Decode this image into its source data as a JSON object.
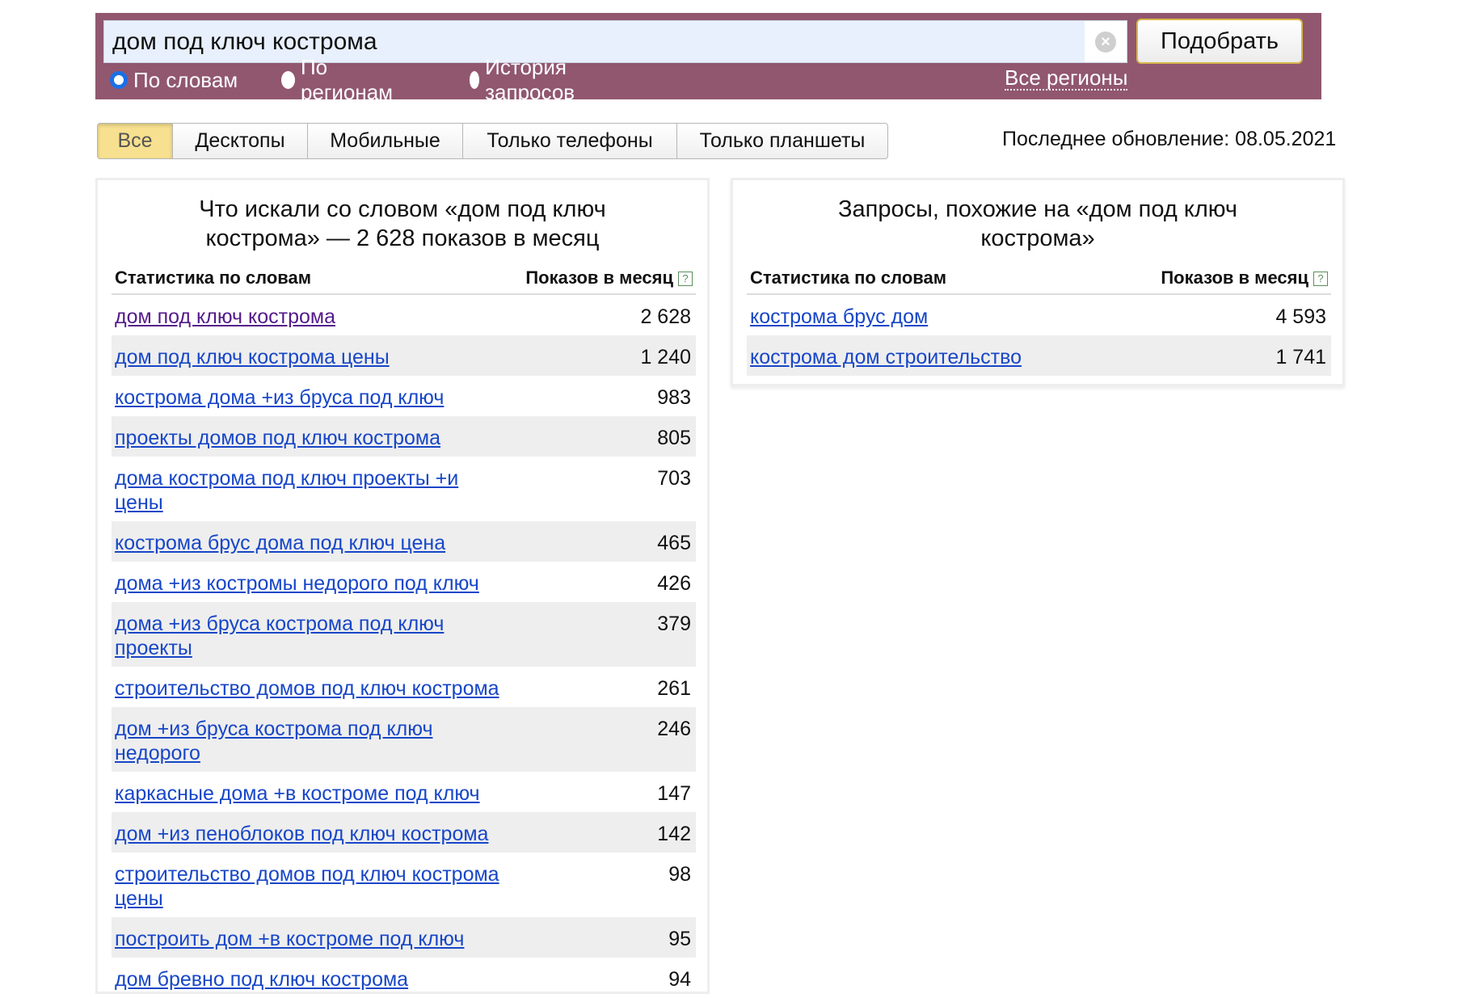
{
  "search": {
    "query": "дом под ключ кострома",
    "submit_label": "Подобрать",
    "modes": [
      {
        "label": "По словам",
        "checked": true
      },
      {
        "label": "По регионам",
        "checked": false
      },
      {
        "label": "История запросов",
        "checked": false
      }
    ],
    "regions_label": "Все регионы"
  },
  "tabs": [
    {
      "label": "Все",
      "active": true
    },
    {
      "label": "Десктопы",
      "active": false
    },
    {
      "label": "Мобильные",
      "active": false
    },
    {
      "label": "Только телефоны",
      "active": false
    },
    {
      "label": "Только планшеты",
      "active": false
    }
  ],
  "last_update": "Последнее обновление: 08.05.2021",
  "left_panel": {
    "title_line1": "Что искали со словом «дом под ключ",
    "title_line2": "кострома» — 2 628 показов в месяц",
    "col_keyword": "Статистика по словам",
    "col_count": "Показов в месяц",
    "hint": "?",
    "rows": [
      {
        "text": "дом под ключ кострома",
        "count": "2 628"
      },
      {
        "text": "дом под ключ кострома цены",
        "count": "1 240"
      },
      {
        "text": "кострома дома +из бруса под ключ",
        "count": "983"
      },
      {
        "text": "проекты домов под ключ кострома",
        "count": "805"
      },
      {
        "text": "дома кострома под ключ проекты +и цены",
        "count": "703"
      },
      {
        "text": "кострома брус дома под ключ цена",
        "count": "465"
      },
      {
        "text": "дома +из костромы недорого под ключ",
        "count": "426"
      },
      {
        "text": "дома +из бруса кострома под ключ проекты",
        "count": "379"
      },
      {
        "text": "строительство домов под ключ кострома",
        "count": "261"
      },
      {
        "text": "дом +из бруса кострома под ключ недорого",
        "count": "246"
      },
      {
        "text": "каркасные дома +в костроме под ключ",
        "count": "147"
      },
      {
        "text": "дом +из пеноблоков под ключ кострома",
        "count": "142"
      },
      {
        "text": "строительство домов под ключ кострома цены",
        "count": "98"
      },
      {
        "text": "построить дом +в костроме под ключ",
        "count": "95"
      },
      {
        "text": "дом бревно под ключ кострома",
        "count": "94"
      }
    ]
  },
  "right_panel": {
    "title_line1": "Запросы, похожие на «дом под ключ",
    "title_line2": "кострома»",
    "col_keyword": "Статистика по словам",
    "col_count": "Показов в месяц",
    "hint": "?",
    "rows": [
      {
        "text": "кострома брус дом",
        "count": "4 593"
      },
      {
        "text": "кострома дом строительство",
        "count": "1 741"
      }
    ]
  },
  "icons": {
    "clear": "clear-icon",
    "hint": "help-icon"
  },
  "colors": {
    "header_bg": "#91576f",
    "active_tab": "#f7e08f",
    "link": "#1746c8",
    "visited_link": "#551a8b"
  }
}
